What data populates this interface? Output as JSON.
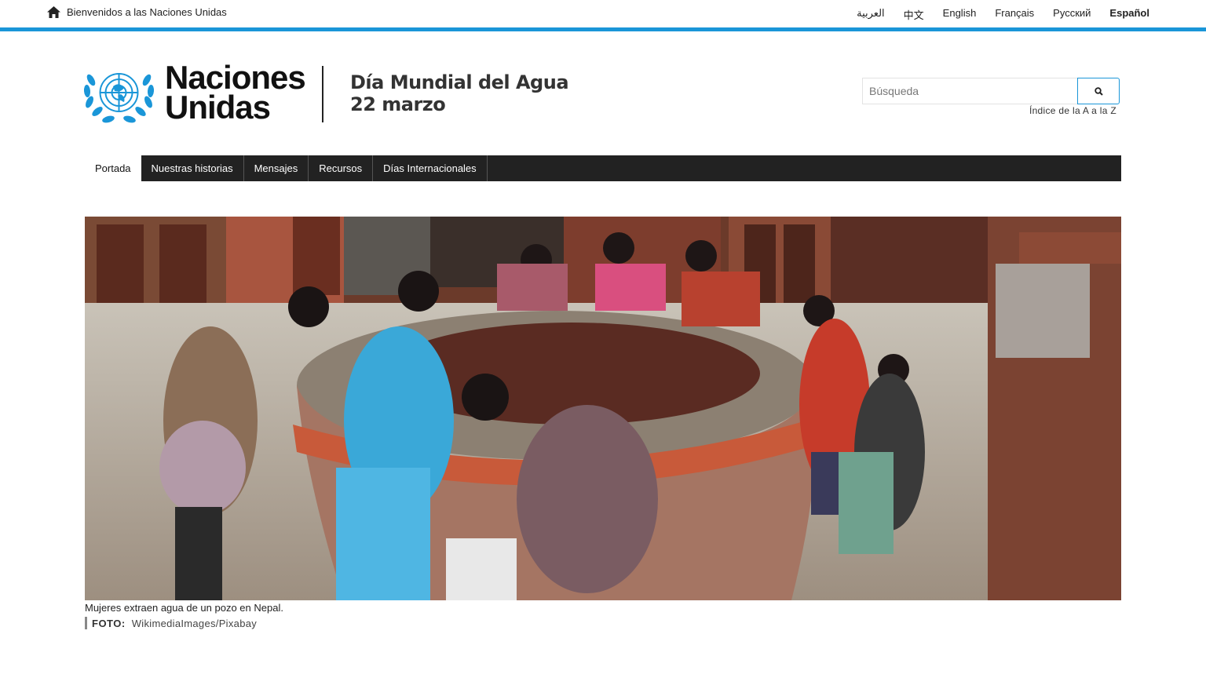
{
  "topbar": {
    "welcome_text": "Bienvenidos a las Naciones Unidas",
    "home_icon": "home-icon",
    "languages": [
      {
        "label": "العربية",
        "active": false
      },
      {
        "label": "中文",
        "active": false
      },
      {
        "label": "English",
        "active": false
      },
      {
        "label": "Français",
        "active": false
      },
      {
        "label": "Русский",
        "active": false
      },
      {
        "label": "Español",
        "active": true
      }
    ],
    "accent_color": "#1a96d8"
  },
  "header": {
    "logo_icon": "un-emblem-icon",
    "logo_line1": "Naciones",
    "logo_line2": "Unidas",
    "event_line1": "Día Mundial del Agua",
    "event_line2": "22 marzo",
    "logo_color": "#1a96d8"
  },
  "search": {
    "placeholder": "Búsqueda",
    "value": "",
    "button_icon": "search-icon",
    "az_link": "Índice de la A a la Z"
  },
  "nav": {
    "items": [
      {
        "label": "Portada",
        "active": true
      },
      {
        "label": "Nuestras historias",
        "active": false
      },
      {
        "label": "Mensajes",
        "active": false
      },
      {
        "label": "Recursos",
        "active": false
      },
      {
        "label": "Días Internacionales",
        "active": false
      }
    ]
  },
  "hero": {
    "caption": "Mujeres extraen agua de un pozo en Nepal.",
    "credit_label": "FOTO:",
    "credit_value": "WikimediaImages/Pixabay"
  }
}
